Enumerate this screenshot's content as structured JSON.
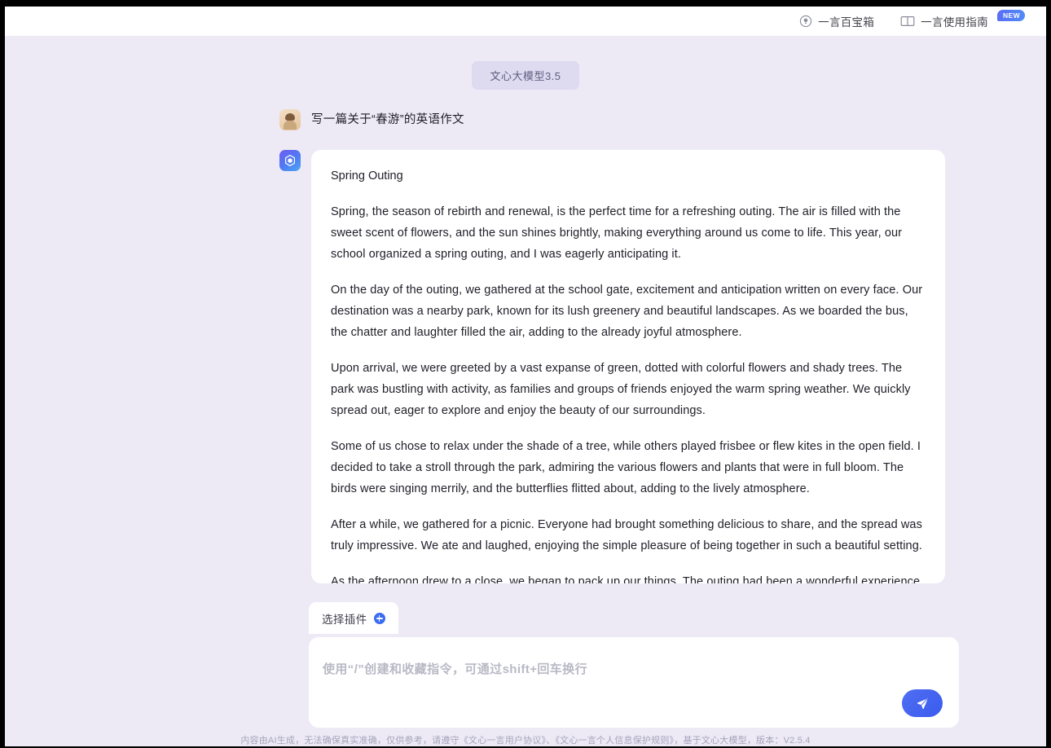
{
  "header": {
    "items": [
      {
        "label": "一言百宝箱",
        "icon": "lightbulb-icon"
      },
      {
        "label": "一言使用指南",
        "icon": "book-icon",
        "badge": "NEW"
      }
    ]
  },
  "chat": {
    "model_pill": "文心大模型3.5",
    "user_message": "写一篇关于“春游”的英语作文",
    "answer": {
      "title": "Spring Outing",
      "paragraphs": [
        "Spring, the season of rebirth and renewal, is the perfect time for a refreshing outing. The air is filled with the sweet scent of flowers, and the sun shines brightly, making everything around us come to life. This year, our school organized a spring outing, and I was eagerly anticipating it.",
        "On the day of the outing, we gathered at the school gate, excitement and anticipation written on every face. Our destination was a nearby park, known for its lush greenery and beautiful landscapes. As we boarded the bus, the chatter and laughter filled the air, adding to the already joyful atmosphere.",
        "Upon arrival, we were greeted by a vast expanse of green, dotted with colorful flowers and shady trees. The park was bustling with activity, as families and groups of friends enjoyed the warm spring weather. We quickly spread out, eager to explore and enjoy the beauty of our surroundings.",
        "Some of us chose to relax under the shade of a tree, while others played frisbee or flew kites in the open field. I decided to take a stroll through the park, admiring the various flowers and plants that were in full bloom. The birds were singing merrily, and the butterflies flitted about, adding to the lively atmosphere.",
        "After a while, we gathered for a picnic. Everyone had brought something delicious to share, and the spread was truly impressive. We ate and laughed, enjoying the simple pleasure of being together in such a beautiful setting.",
        "As the afternoon drew to a close, we began to pack up our things. The outing had been a wonderful experience, and I was already looking forward to the next one. As we boarded the bus back to school, I couldn't help but"
      ]
    }
  },
  "composer": {
    "plugin_label": "选择插件",
    "input_placeholder": "使用“/”创建和收藏指令，可通过shift+回车换行",
    "send_icon": "send-plane-icon"
  },
  "footer": {
    "text_1": "内容由AI生成，无法确保真实准确，仅供参考，请遵守",
    "link_1": "《文心一言用户协议》",
    "text_2": "、",
    "link_2": "《文心一言个人信息保护规则》",
    "text_3": "，基于文心大模型，版本：V2.5.4"
  },
  "colors": {
    "page_bg": "#edeaf6",
    "accent": "#3a5bee",
    "card_bg": "#ffffff",
    "pill_bg": "#dedaf0"
  }
}
